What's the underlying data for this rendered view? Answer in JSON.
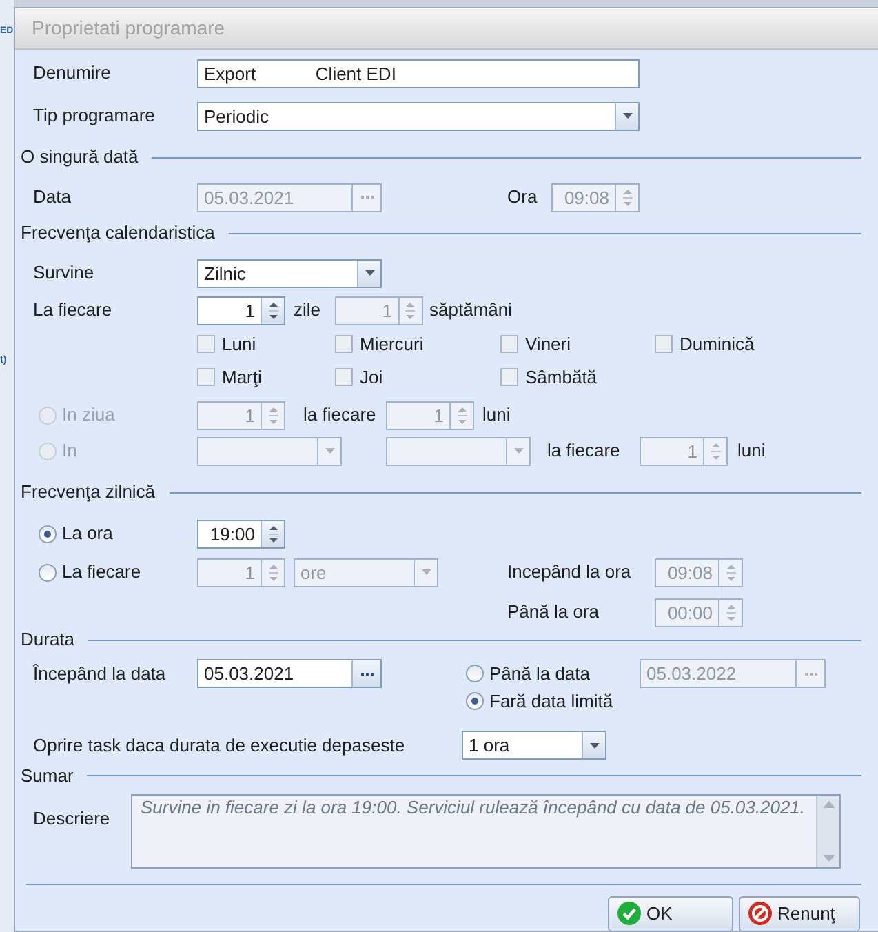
{
  "backdrop": {
    "fragments": [
      "ED",
      "t)"
    ]
  },
  "window": {
    "title": "Proprietati programare"
  },
  "general": {
    "name": {
      "label": "Denumire",
      "value": "Export            Client EDI",
      "disabled": false
    },
    "type": {
      "label": "Tip programare",
      "value": "Periodic",
      "disabled": false
    }
  },
  "once": {
    "title": "O singură dată",
    "date": {
      "label": "Data",
      "value": "05.03.2021",
      "disabled": true
    },
    "time": {
      "label": "Ora",
      "value": "09:08",
      "disabled": true
    }
  },
  "calendar": {
    "title": "Frecvenţa calendaristica",
    "occurs": {
      "label": "Survine",
      "value": "Zilnic",
      "disabled": false
    },
    "every": {
      "label": "La fiecare",
      "days": {
        "value": "1",
        "disabled": false
      },
      "days_unit": "zile",
      "weeks": {
        "value": "1",
        "disabled": true
      },
      "weeks_unit": "săptămâni"
    },
    "weekdays": [
      {
        "label": "Luni",
        "checked": false,
        "disabled": false
      },
      {
        "label": "Miercuri",
        "checked": false,
        "disabled": false
      },
      {
        "label": "Vineri",
        "checked": false,
        "disabled": false
      },
      {
        "label": "Duminică",
        "checked": false,
        "disabled": false
      },
      {
        "label": "Marţi",
        "checked": false,
        "disabled": false
      },
      {
        "label": "Joi",
        "checked": false,
        "disabled": false
      },
      {
        "label": "Sâmbătă",
        "checked": false,
        "disabled": false
      }
    ],
    "monthly_day": {
      "label": "In ziua",
      "selected": false,
      "disabled": true,
      "day": {
        "value": "1",
        "disabled": true
      },
      "every_label": "la fiecare",
      "months": {
        "value": "1",
        "disabled": true
      },
      "unit": "luni"
    },
    "monthly_pattern": {
      "label": "In",
      "selected": false,
      "disabled": true,
      "which": {
        "disabled": true
      },
      "weekday": {
        "disabled": true
      },
      "every_label": "la fiecare",
      "months": {
        "value": "1",
        "disabled": true
      },
      "unit": "luni"
    }
  },
  "daily": {
    "title": "Frecvenţa zilnică",
    "at": {
      "label": "La ora",
      "selected": true,
      "disabled": false,
      "time": {
        "value": "19:00",
        "disabled": false
      }
    },
    "every": {
      "label": "La fiecare",
      "selected": false,
      "disabled": false,
      "count": {
        "value": "1",
        "disabled": true
      },
      "unit": {
        "value": "ore",
        "disabled": true
      }
    },
    "start": {
      "label": "Incepând la ora",
      "value": "09:08",
      "disabled": true
    },
    "end": {
      "label": "Până la ora",
      "value": "00:00",
      "disabled": true
    }
  },
  "duration": {
    "title": "Durata",
    "start": {
      "label": "Începând la data",
      "value": "05.03.2021",
      "disabled": false
    },
    "end_options": [
      {
        "label": "Până la data",
        "selected": false,
        "disabled": false,
        "date": {
          "value": "05.03.2022",
          "disabled": true
        }
      },
      {
        "label": "Fară data limită",
        "selected": true,
        "disabled": false
      }
    ]
  },
  "stop": {
    "label": "Oprire task daca durata de executie depaseste",
    "value": "1 ora",
    "disabled": false
  },
  "summary": {
    "title": "Sumar",
    "label": "Descriere",
    "text": "Survine in fiecare zi la ora 19:00. Serviciul rulează începând cu data de 05.03.2021."
  },
  "buttons": [
    {
      "label": "OK",
      "kind": "ok"
    },
    {
      "label": "Renunţ",
      "kind": "cancel"
    }
  ]
}
